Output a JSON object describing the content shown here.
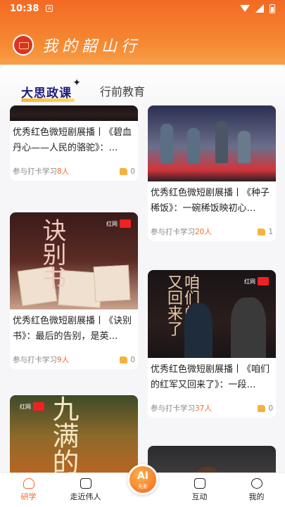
{
  "status_bar": {
    "time": "10:38",
    "badge": "A"
  },
  "header": {
    "title": "我的韶山行"
  },
  "tabs": [
    {
      "label": "大思政课"
    },
    {
      "label": "行前教育"
    }
  ],
  "cards": [
    {
      "title": "优秀红色微短剧展播丨《碧血丹心——人民的骆驼》：…",
      "participants_prefix": "参与打卡学习",
      "participants_count": "8人",
      "likes": "0"
    },
    {
      "title": "优秀红色微短剧展播丨《种子稀饭》：一碗稀饭映初心…",
      "participants_prefix": "参与打卡学习",
      "participants_count": "20人",
      "likes": "1"
    },
    {
      "title": "优秀红色微短剧展播丨《诀别书》：最后的告别，是英…",
      "participants_prefix": "参与打卡学习",
      "participants_count": "9人",
      "likes": "0",
      "thumb_text": "诀别书"
    },
    {
      "title": "优秀红色微短剧展播丨《咱们的红军又回来了》：一段…",
      "participants_prefix": "参与打卡学习",
      "participants_count": "37人",
      "likes": "0",
      "thumb_text": "咱们的红军又回来了"
    },
    {
      "thumb_text": "九满的"
    }
  ],
  "bottom_nav": {
    "items": [
      {
        "label": "研学",
        "icon": "home-icon"
      },
      {
        "label": "走近伟人",
        "icon": "monitor-icon"
      },
      {
        "label": "互动",
        "icon": "chat-icon"
      },
      {
        "label": "我的",
        "icon": "profile-icon"
      }
    ],
    "ai": {
      "label": "AI",
      "sub": "光影"
    }
  },
  "colors": {
    "brand_orange": "#f26b2c",
    "header_top": "#f36a24"
  }
}
